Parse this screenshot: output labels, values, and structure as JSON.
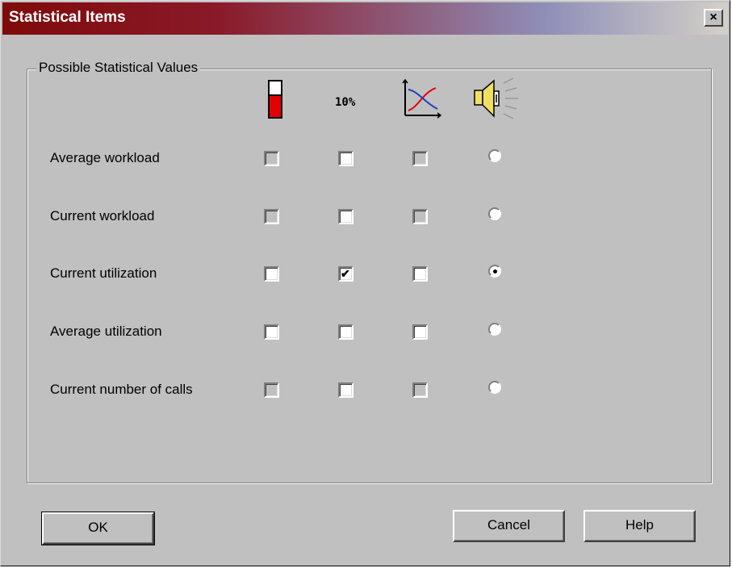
{
  "window": {
    "title": "Statistical Items",
    "close_glyph": "×"
  },
  "group": {
    "label": "Possible Statistical Values",
    "column_headers": [
      {
        "icon": "thermometer-bar-icon"
      },
      {
        "icon": "percent-text-icon",
        "text": "10%"
      },
      {
        "icon": "line-graph-icon"
      },
      {
        "icon": "speaker-icon"
      }
    ]
  },
  "rows": [
    {
      "label": "Average workload",
      "col1": {
        "checked": false,
        "enabled": false
      },
      "col2": {
        "checked": false,
        "enabled": true
      },
      "col3": {
        "checked": false,
        "enabled": false
      },
      "radio": false
    },
    {
      "label": "Current workload",
      "col1": {
        "checked": false,
        "enabled": false
      },
      "col2": {
        "checked": false,
        "enabled": true
      },
      "col3": {
        "checked": false,
        "enabled": false
      },
      "radio": false
    },
    {
      "label": "Current utilization",
      "col1": {
        "checked": false,
        "enabled": true
      },
      "col2": {
        "checked": true,
        "enabled": true
      },
      "col3": {
        "checked": false,
        "enabled": true
      },
      "radio": true
    },
    {
      "label": "Average utilization",
      "col1": {
        "checked": false,
        "enabled": true
      },
      "col2": {
        "checked": false,
        "enabled": true
      },
      "col3": {
        "checked": false,
        "enabled": true
      },
      "radio": false
    },
    {
      "label": "Current number of calls",
      "col1": {
        "checked": false,
        "enabled": false
      },
      "col2": {
        "checked": false,
        "enabled": true
      },
      "col3": {
        "checked": false,
        "enabled": false
      },
      "radio": false
    }
  ],
  "buttons": {
    "ok": "OK",
    "cancel": "Cancel",
    "help": "Help"
  },
  "colors": {
    "face": "#c0c0c0",
    "title_start": "#7f0a0a",
    "title_end": "#d4d0c8",
    "thermometer_fill": "#e00000",
    "graph_red": "#e00000",
    "graph_blue": "#1f3fbf"
  }
}
